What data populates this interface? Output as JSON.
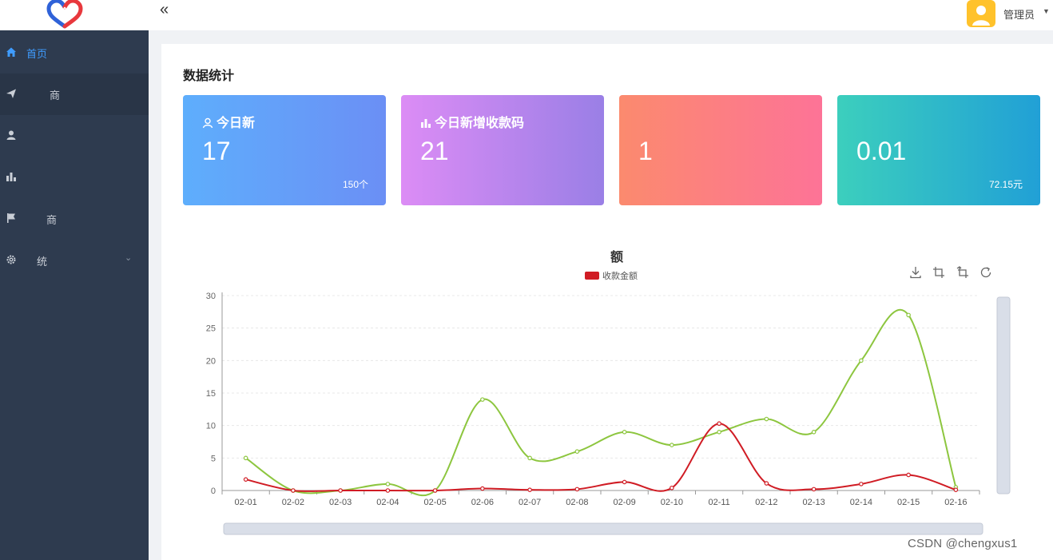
{
  "header": {
    "collapse_icon": "double-chevron-left-icon",
    "user_name": "管理员",
    "caret": "▼"
  },
  "sidebar": {
    "items": [
      {
        "label": "首页",
        "icon": "home-icon",
        "active": true
      },
      {
        "label": "商",
        "icon": "paper-plane-icon"
      },
      {
        "label": "",
        "icon": "user-icon"
      },
      {
        "label": "",
        "icon": "bar-chart-icon"
      },
      {
        "label": "商",
        "icon": "flag-icon"
      },
      {
        "label": "统",
        "icon": "gear-icon"
      }
    ],
    "expand_caret": "⌄"
  },
  "main": {
    "section_title": "数据统计",
    "cards": [
      {
        "title": "今日新",
        "value": "17",
        "footer_left": "",
        "footer_right": "150个",
        "icon": "user-outline-icon"
      },
      {
        "title": "今日新增收款码",
        "value": "21",
        "footer_left": "",
        "footer_right": "",
        "icon": "bar-chart-icon"
      },
      {
        "title": "",
        "value": "1",
        "footer_left": "",
        "footer_right": ""
      },
      {
        "title": "",
        "value": "0.01",
        "footer_left": "",
        "footer_right": "72.15元"
      }
    ]
  },
  "chart_data": {
    "type": "line",
    "title": "额",
    "categories": [
      "02-01",
      "02-02",
      "02-03",
      "02-04",
      "02-05",
      "02-06",
      "02-07",
      "02-08",
      "02-09",
      "02-10",
      "02-11",
      "02-12",
      "02-13",
      "02-14",
      "02-15",
      "02-16"
    ],
    "series": [
      {
        "name": "收款金额",
        "color": "#d01c24",
        "values": [
          1.7,
          0,
          0,
          0,
          0,
          0.3,
          0.1,
          0.2,
          1.3,
          0.4,
          10.3,
          1.1,
          0.2,
          1.0,
          2.4,
          0.1
        ]
      },
      {
        "color": "#8dc63f",
        "values": [
          5,
          0,
          0,
          1,
          0,
          14,
          5,
          6,
          9,
          7,
          9,
          11,
          9,
          20,
          27,
          0.5
        ]
      }
    ],
    "y_ticks": [
      0,
      5,
      10,
      15,
      20,
      25,
      30
    ],
    "ylim": [
      0,
      30
    ],
    "smooth": true,
    "legend_position": "top-center",
    "grid": "horizontal-dashed",
    "toolbox_icons": [
      "download-icon",
      "zoom-select-icon",
      "zoom-reset-icon",
      "refresh-icon"
    ],
    "data_zoom": "horizontal-and-vertical-sliders"
  },
  "watermark": "CSDN @chengxus1"
}
